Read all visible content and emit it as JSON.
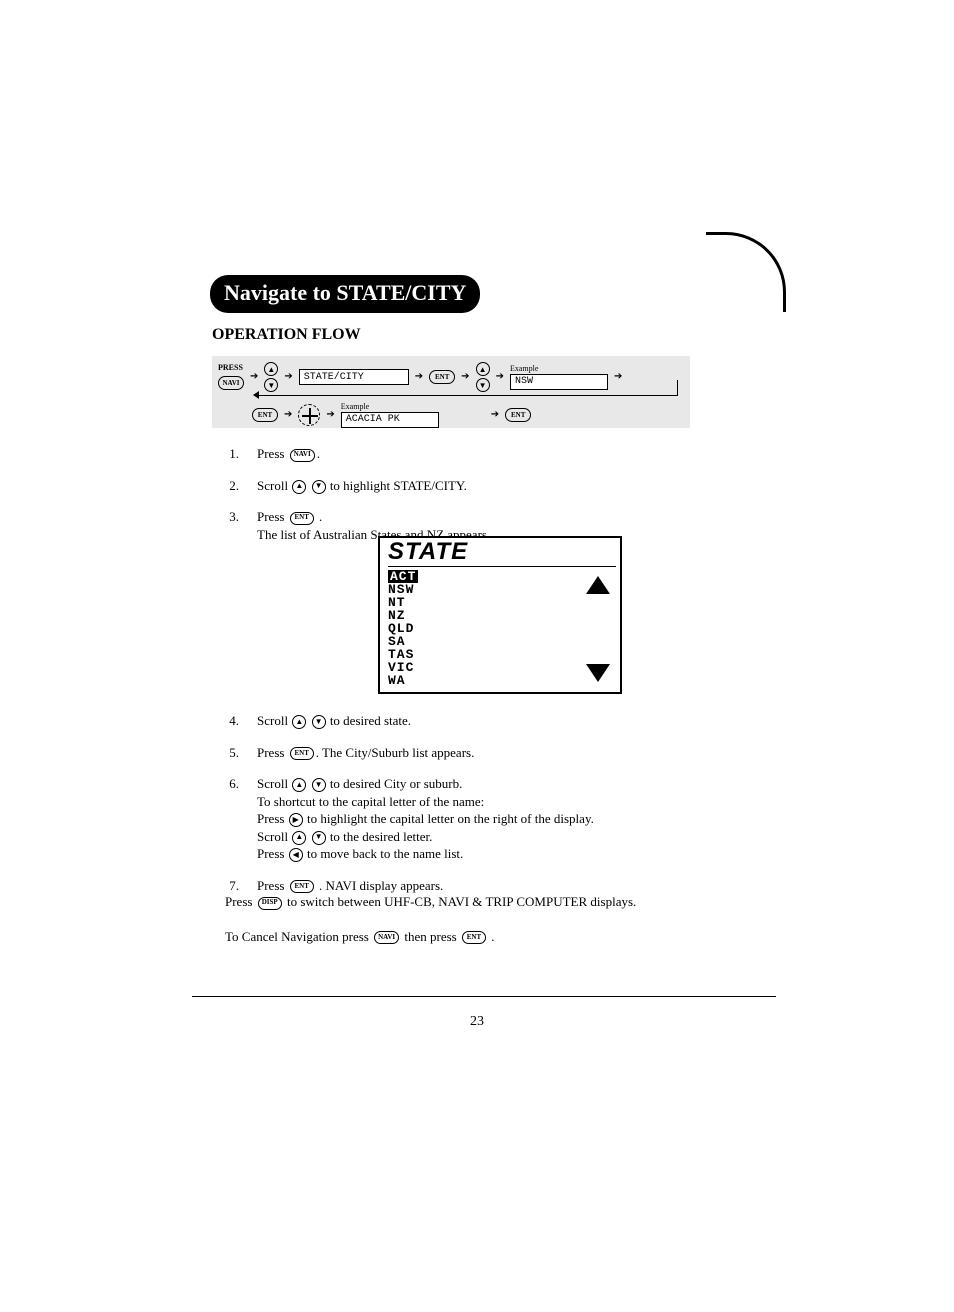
{
  "title": "Navigate to STATE/CITY",
  "section_header": "OPERATION FLOW",
  "page_number": "23",
  "flow": {
    "press_label": "PRESS",
    "navi_btn": "NAVI",
    "ent_btn": "ENT",
    "example_label": "Example",
    "display1": "STATE/CITY",
    "display2": "NSW",
    "display3": "ACACIA PK"
  },
  "buttons": {
    "navi": "NAVI",
    "ent": "ENT",
    "disp": "DISP"
  },
  "steps_a": [
    {
      "n": "1.",
      "pre": "Press ",
      "btn": "NAVI",
      "post": "."
    },
    {
      "n": "2.",
      "text_scroll": "Scroll ",
      "post": " to highlight STATE/CITY."
    },
    {
      "n": "3.",
      "pre": "Press ",
      "btn": "ENT",
      "post": " .",
      "sub": "The list of Australian States and NZ appears."
    }
  ],
  "lcd": {
    "title": "STATE",
    "selected": "ACT",
    "items": [
      "NSW",
      "NT",
      "NZ",
      "QLD",
      "SA",
      "TAS",
      "VIC",
      "WA"
    ]
  },
  "steps_b": [
    {
      "n": "4.",
      "scroll": true,
      "post": " to desired state."
    },
    {
      "n": "5.",
      "pre": "Press ",
      "btn": "ENT",
      "post": ". The City/Suburb list appears."
    },
    {
      "n": "6.",
      "scroll": true,
      "post": " to desired City or suburb.",
      "lines": [
        "To shortcut to the capital letter of the name:",
        {
          "pre": "Press ",
          "circ": "▶",
          "post": " to highlight the capital letter on the right of the display."
        },
        {
          "pre": "Scroll ",
          "circ2": true,
          "post": " to the desired letter."
        },
        {
          "pre": "Press ",
          "circ": "◀",
          "post": " to move back to the name list."
        }
      ]
    },
    {
      "n": "7.",
      "pre": "Press ",
      "btn": "ENT",
      "post": " . NAVI display appears."
    }
  ],
  "bottom": {
    "line1_pre": "Press ",
    "line1_btn": "DISP",
    "line1_post": " to switch between UHF-CB, NAVI & TRIP COMPUTER displays.",
    "line2_pre": "To Cancel Navigation press ",
    "line2_btn1": "NAVI",
    "line2_mid": " then press ",
    "line2_btn2": "ENT",
    "line2_post": " ."
  }
}
